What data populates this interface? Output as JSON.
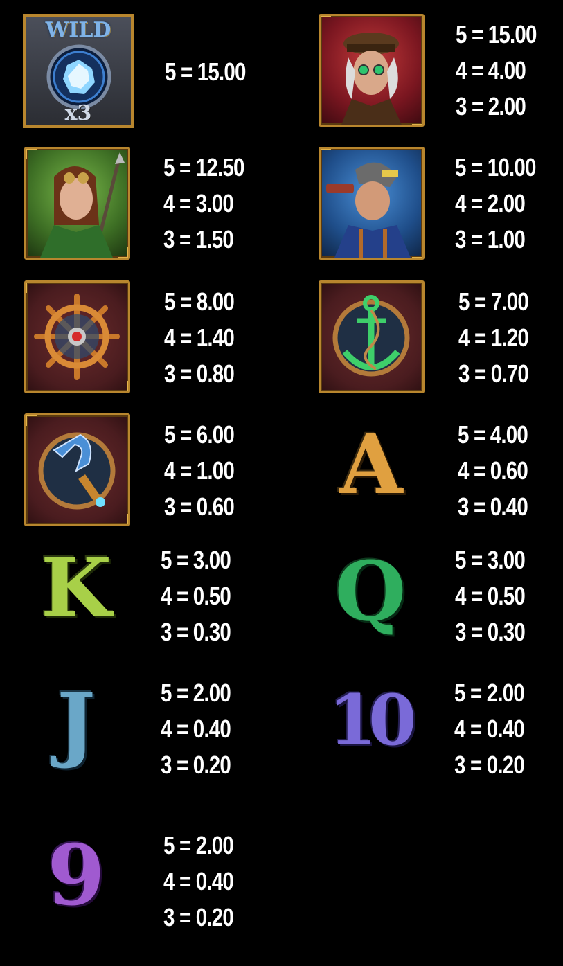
{
  "symbols": [
    {
      "id": "wild",
      "label": "WILD",
      "multiplier": "x3",
      "pays": [
        "5 = 15.00"
      ]
    },
    {
      "id": "captain",
      "pays": [
        "5 = 15.00",
        "4 = 4.00",
        "3 = 2.00"
      ]
    },
    {
      "id": "woman",
      "pays": [
        "5 = 12.50",
        "4 = 3.00",
        "3 = 1.50"
      ]
    },
    {
      "id": "mechanic",
      "pays": [
        "5 = 10.00",
        "4 = 2.00",
        "3 = 1.00"
      ]
    },
    {
      "id": "wheel",
      "pays": [
        "5 = 8.00",
        "4 = 1.40",
        "3 = 0.80"
      ]
    },
    {
      "id": "anchor",
      "pays": [
        "5 = 7.00",
        "4 = 1.20",
        "3 = 0.70"
      ]
    },
    {
      "id": "hook",
      "pays": [
        "5 = 6.00",
        "4 = 1.00",
        "3 = 0.60"
      ]
    },
    {
      "id": "a",
      "label": "A",
      "pays": [
        "5 = 4.00",
        "4 = 0.60",
        "3 = 0.40"
      ]
    },
    {
      "id": "k",
      "label": "K",
      "pays": [
        "5 = 3.00",
        "4 = 0.50",
        "3 = 0.30"
      ]
    },
    {
      "id": "q",
      "label": "Q",
      "pays": [
        "5 = 3.00",
        "4 = 0.50",
        "3 = 0.30"
      ]
    },
    {
      "id": "j",
      "label": "J",
      "pays": [
        "5 = 2.00",
        "4 = 0.40",
        "3 = 0.20"
      ]
    },
    {
      "id": "ten",
      "label": "10",
      "pays": [
        "5 = 2.00",
        "4 = 0.40",
        "3 = 0.20"
      ]
    },
    {
      "id": "nine",
      "label": "9",
      "pays": [
        "5 = 2.00",
        "4 = 0.40",
        "3 = 0.20"
      ]
    }
  ]
}
